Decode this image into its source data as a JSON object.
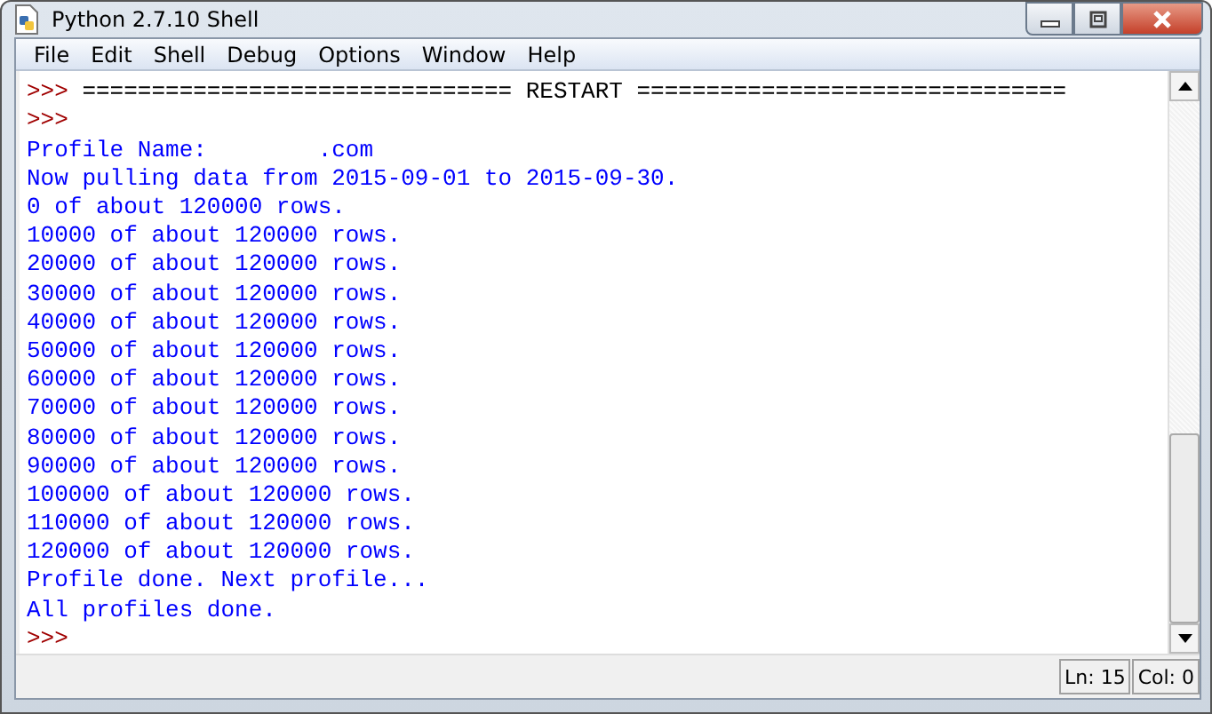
{
  "window": {
    "title": "Python 2.7.10 Shell"
  },
  "menu": [
    "File",
    "Edit",
    "Shell",
    "Debug",
    "Options",
    "Window",
    "Help"
  ],
  "lines": [
    {
      "kind": "prompt",
      "prompt": ">>>",
      "text": " =============================== RESTART ==============================="
    },
    {
      "kind": "prompt",
      "prompt": ">>>"
    },
    {
      "kind": "output",
      "text": "Profile Name:        .com"
    },
    {
      "kind": "output",
      "text": "Now pulling data from 2015-09-01 to 2015-09-30."
    },
    {
      "kind": "output",
      "text": "0 of about 120000 rows."
    },
    {
      "kind": "output",
      "text": "10000 of about 120000 rows."
    },
    {
      "kind": "output",
      "text": "20000 of about 120000 rows."
    },
    {
      "kind": "output",
      "text": "30000 of about 120000 rows."
    },
    {
      "kind": "output",
      "text": "40000 of about 120000 rows."
    },
    {
      "kind": "output",
      "text": "50000 of about 120000 rows."
    },
    {
      "kind": "output",
      "text": "60000 of about 120000 rows."
    },
    {
      "kind": "output",
      "text": "70000 of about 120000 rows."
    },
    {
      "kind": "output",
      "text": "80000 of about 120000 rows."
    },
    {
      "kind": "output",
      "text": "90000 of about 120000 rows."
    },
    {
      "kind": "output",
      "text": "100000 of about 120000 rows."
    },
    {
      "kind": "output",
      "text": "110000 of about 120000 rows."
    },
    {
      "kind": "output",
      "text": "120000 of about 120000 rows."
    },
    {
      "kind": "output",
      "text": "Profile done. Next profile..."
    },
    {
      "kind": "output",
      "text": "All profiles done."
    },
    {
      "kind": "prompt",
      "prompt": ">>>"
    }
  ],
  "status_bar": {
    "line": "Ln: 15",
    "column": "Col: 0"
  }
}
